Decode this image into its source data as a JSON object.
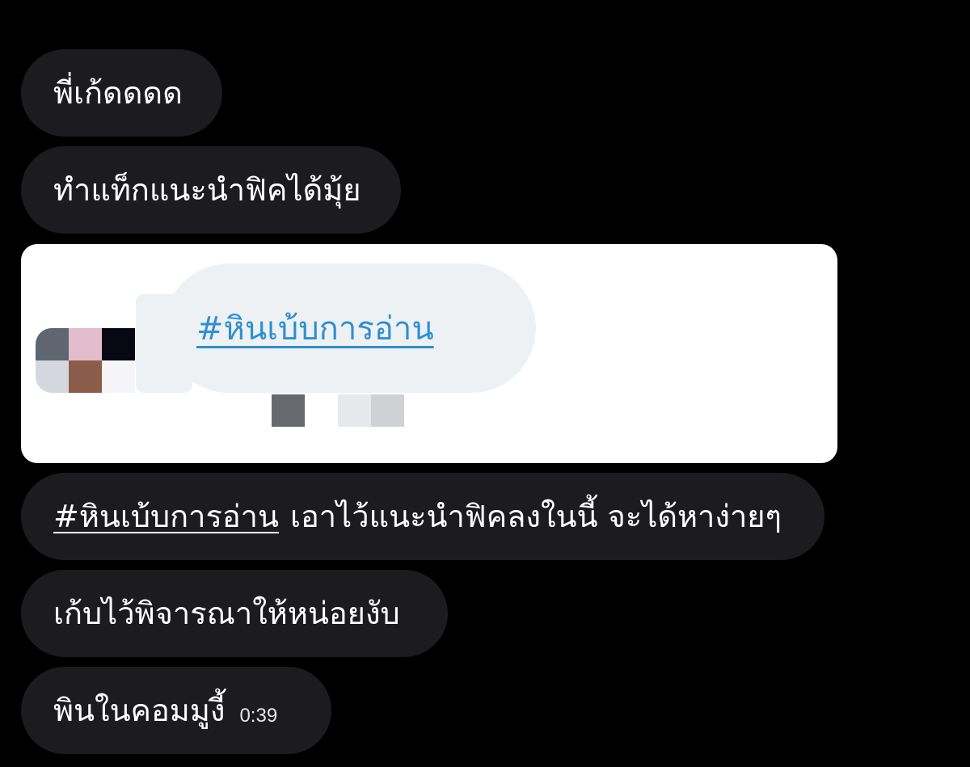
{
  "messages": [
    {
      "text": "พี่เก้ดดดด"
    },
    {
      "text": "ทำแท็กแนะนำฟิคได้มุ้ย"
    },
    {
      "image": {
        "hashtag": "#หินเบ้บการอ่าน",
        "colors": {
          "background": "#ffffff",
          "bubble": "#eef1f4",
          "link": "#2f8fcf"
        }
      }
    },
    {
      "hashtag": "#หินเบ้บการอ่าน",
      "text": "เอาไว้แนะนำฟิคลงในนี้ จะได้หาง่ายๆ"
    },
    {
      "text": "เก้บไว้พิจารณาให้หน่อยงับ"
    },
    {
      "text": "พินในคอมมูงี้",
      "time": "0:39"
    }
  ],
  "colors": {
    "page_background": "#000000",
    "bubble_background": "#1c1c1e",
    "text": "#ffffff"
  }
}
